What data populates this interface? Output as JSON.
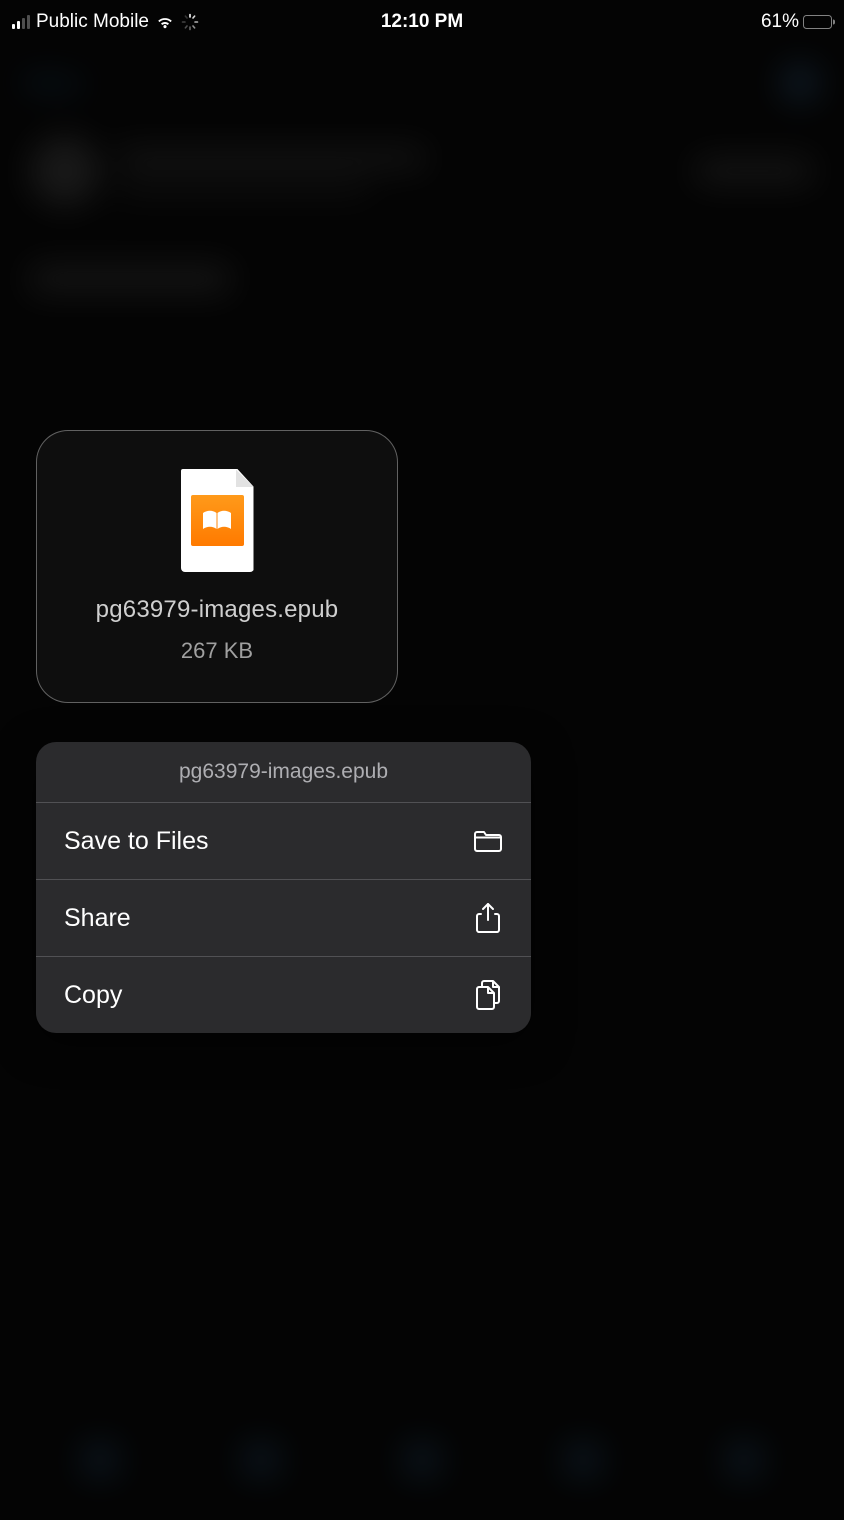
{
  "status_bar": {
    "carrier": "Public Mobile",
    "time": "12:10 PM",
    "battery_percent": "61%",
    "battery_level": 61
  },
  "file": {
    "name": "pg63979-images.epub",
    "size": "267 KB"
  },
  "menu": {
    "header": "pg63979-images.epub",
    "items": [
      {
        "label": "Save to Files",
        "icon": "folder-icon"
      },
      {
        "label": "Share",
        "icon": "share-icon"
      },
      {
        "label": "Copy",
        "icon": "duplicate-icon"
      }
    ]
  }
}
